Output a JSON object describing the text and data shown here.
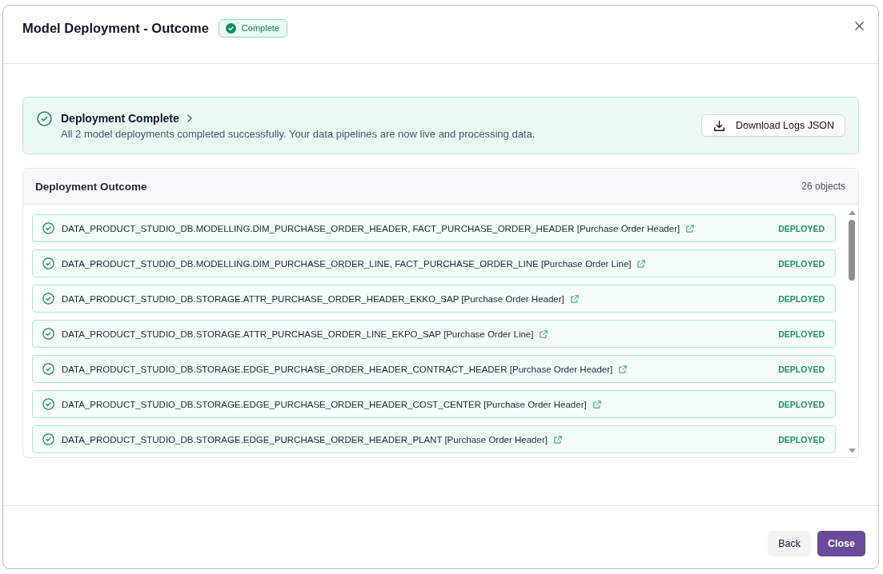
{
  "dialog": {
    "title": "Model Deployment - Outcome",
    "status_badge": {
      "label": "Complete"
    }
  },
  "banner": {
    "title": "Deployment Complete",
    "message": "All 2 model deployments completed successfully. Your data pipelines are now live and processing data.",
    "download_button": "Download Logs JSON"
  },
  "outcome": {
    "title": "Deployment Outcome",
    "count": "26 objects",
    "items": [
      {
        "name": "DATA_PRODUCT_STUDIO_DB.MODELLING.DIM_PURCHASE_ORDER_HEADER, FACT_PURCHASE_ORDER_HEADER [Purchase Order Header]",
        "status": "DEPLOYED"
      },
      {
        "name": "DATA_PRODUCT_STUDIO_DB.MODELLING.DIM_PURCHASE_ORDER_LINE, FACT_PURCHASE_ORDER_LINE [Purchase Order Line]",
        "status": "DEPLOYED"
      },
      {
        "name": "DATA_PRODUCT_STUDIO_DB.STORAGE.ATTR_PURCHASE_ORDER_HEADER_EKKO_SAP [Purchase Order Header]",
        "status": "DEPLOYED"
      },
      {
        "name": "DATA_PRODUCT_STUDIO_DB.STORAGE.ATTR_PURCHASE_ORDER_LINE_EKPO_SAP [Purchase Order Line]",
        "status": "DEPLOYED"
      },
      {
        "name": "DATA_PRODUCT_STUDIO_DB.STORAGE.EDGE_PURCHASE_ORDER_HEADER_CONTRACT_HEADER [Purchase Order Header]",
        "status": "DEPLOYED"
      },
      {
        "name": "DATA_PRODUCT_STUDIO_DB.STORAGE.EDGE_PURCHASE_ORDER_HEADER_COST_CENTER [Purchase Order Header]",
        "status": "DEPLOYED"
      },
      {
        "name": "DATA_PRODUCT_STUDIO_DB.STORAGE.EDGE_PURCHASE_ORDER_HEADER_PLANT [Purchase Order Header]",
        "status": "DEPLOYED"
      }
    ]
  },
  "footer": {
    "buttons": [
      {
        "label": "Back",
        "kind": "secondary"
      },
      {
        "label": "Close",
        "kind": "primary"
      }
    ]
  }
}
